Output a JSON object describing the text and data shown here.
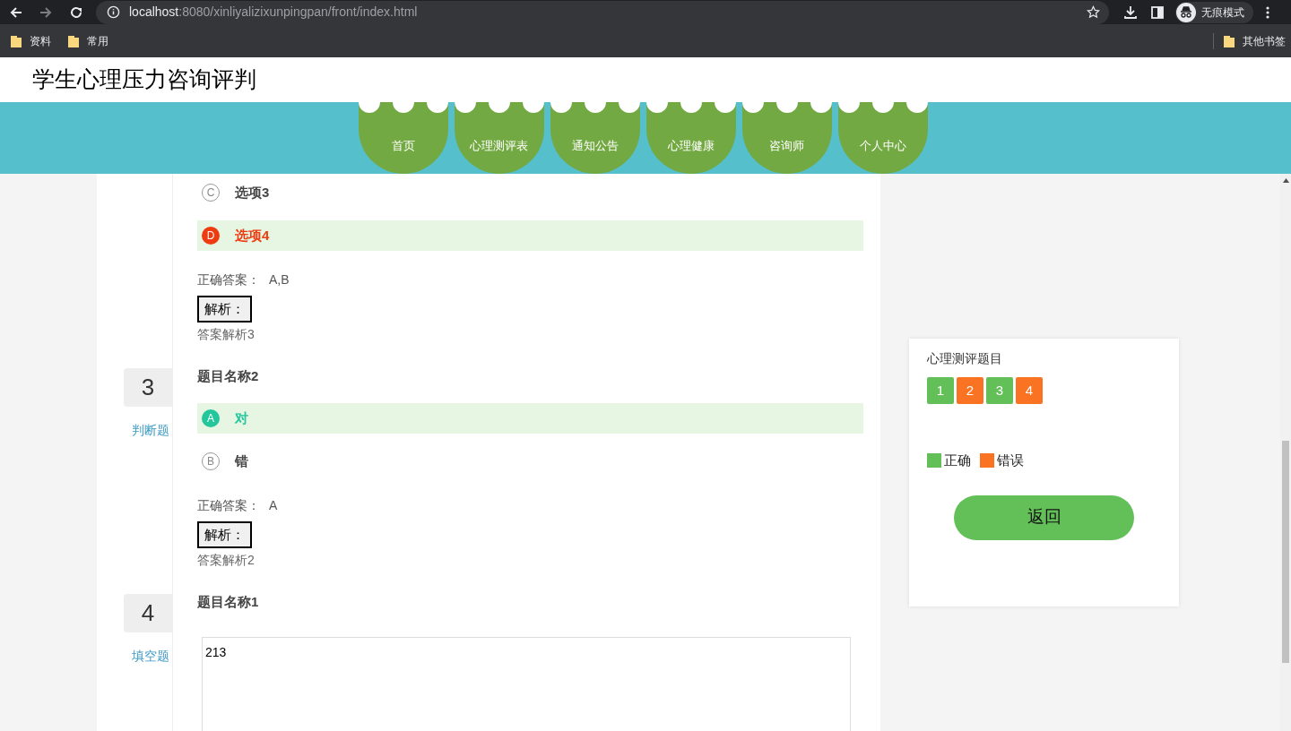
{
  "browser": {
    "url_host": "localhost",
    "url_rest": ":8080/xinliyalizixunpingpan/front/index.html",
    "profile_label": "无痕模式",
    "bookmarks": [
      "资料",
      "常用"
    ],
    "other_bookmarks": "其他书签"
  },
  "site": {
    "title": "学生心理压力咨询评判",
    "nav": [
      {
        "label": "首页"
      },
      {
        "label": "心理测评表"
      },
      {
        "label": "通知公告"
      },
      {
        "label": "心理健康"
      },
      {
        "label": "咨询师"
      },
      {
        "label": "个人中心"
      }
    ]
  },
  "questions": [
    {
      "kind": "choice",
      "options": [
        {
          "letter": "C",
          "text": "选项3",
          "kind": "normal"
        },
        {
          "letter": "D",
          "text": "选项4",
          "kind": "wrong"
        }
      ],
      "answer_label": "正确答案：",
      "answer": "A,B",
      "analysis_label": "解析：",
      "analysis": "答案解析3"
    },
    {
      "kind": "choice",
      "number": "3",
      "type": "判断题",
      "title": "题目名称2",
      "options": [
        {
          "letter": "A",
          "text": "对",
          "kind": "correct"
        },
        {
          "letter": "B",
          "text": "错",
          "kind": "normal"
        }
      ],
      "answer_label": "正确答案：",
      "answer": "A",
      "analysis_label": "解析：",
      "analysis": "答案解析2"
    },
    {
      "kind": "fill",
      "number": "4",
      "type": "填空题",
      "title": "题目名称1",
      "value": "213"
    }
  ],
  "panel": {
    "title": "心理测评题目",
    "items": [
      {
        "label": "1",
        "correct": true
      },
      {
        "label": "2",
        "correct": false
      },
      {
        "label": "3",
        "correct": true
      },
      {
        "label": "4",
        "correct": false
      }
    ],
    "legend": [
      {
        "label": "正确",
        "color": "#63bf58"
      },
      {
        "label": "错误",
        "color": "#fa7322"
      }
    ],
    "button": "返回"
  }
}
